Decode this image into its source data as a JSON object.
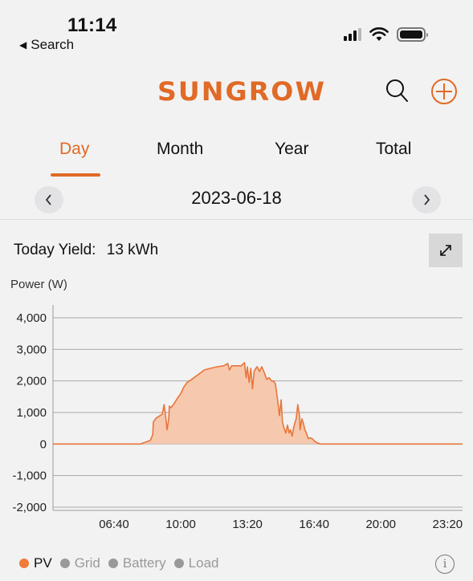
{
  "status_bar": {
    "time": "11:14",
    "back_label": "Search",
    "signal_bars": 3,
    "signal_total": 4,
    "battery_level": 1.0
  },
  "header": {
    "brand": "SUNGROW",
    "brand_color": "#e06a26",
    "search_icon": "search-icon",
    "add_icon": "plus-circle-icon"
  },
  "tabs": [
    {
      "label": "Day",
      "active": true
    },
    {
      "label": "Month",
      "active": false
    },
    {
      "label": "Year",
      "active": false
    },
    {
      "label": "Total",
      "active": false
    }
  ],
  "date_nav": {
    "date": "2023-06-18",
    "prev_icon": "chevron-left-icon",
    "next_icon": "chevron-right-icon"
  },
  "summary": {
    "yield_label": "Today Yield:",
    "yield_value": "13 kWh",
    "expand_icon": "expand-icon"
  },
  "legend": {
    "items": [
      {
        "label": "PV",
        "color": "#ef7a3a",
        "active": true
      },
      {
        "label": "Grid",
        "color": "#999999",
        "active": false
      },
      {
        "label": "Battery",
        "color": "#999999",
        "active": false
      },
      {
        "label": "Load",
        "color": "#999999",
        "active": false
      }
    ],
    "info_icon": "info-icon"
  },
  "chart_data": {
    "type": "area",
    "title": "",
    "ylabel": "Power (W)",
    "xlabel": "",
    "ylim": [
      -2000,
      4000
    ],
    "xlim_minutes": [
      217,
      1445
    ],
    "yticks": [
      4000,
      3000,
      2000,
      1000,
      0,
      -1000,
      -2000
    ],
    "ytick_labels": [
      "4,000",
      "3,000",
      "2,000",
      "1,000",
      "0",
      "-1,000",
      "-2,000"
    ],
    "xticks_minutes": [
      400,
      600,
      800,
      1000,
      1200,
      1400
    ],
    "xtick_labels": [
      "06:40",
      "10:00",
      "13:20",
      "16:40",
      "20:00",
      "23:20"
    ],
    "grid": true,
    "legend_position": "bottom-left",
    "series": [
      {
        "name": "PV",
        "color": "#e8763a",
        "fill": "#f6c8ad",
        "points": [
          [
            217,
            0
          ],
          [
            300,
            0
          ],
          [
            480,
            0
          ],
          [
            485,
            30
          ],
          [
            497,
            70
          ],
          [
            509,
            120
          ],
          [
            516,
            300
          ],
          [
            518,
            700
          ],
          [
            526,
            820
          ],
          [
            535,
            880
          ],
          [
            545,
            950
          ],
          [
            550,
            1250
          ],
          [
            554,
            950
          ],
          [
            559,
            450
          ],
          [
            564,
            800
          ],
          [
            566,
            1200
          ],
          [
            571,
            1150
          ],
          [
            581,
            1300
          ],
          [
            590,
            1450
          ],
          [
            600,
            1600
          ],
          [
            609,
            1800
          ],
          [
            619,
            1950
          ],
          [
            633,
            2050
          ],
          [
            652,
            2200
          ],
          [
            671,
            2350
          ],
          [
            690,
            2400
          ],
          [
            710,
            2450
          ],
          [
            729,
            2480
          ],
          [
            741,
            2550
          ],
          [
            746,
            2350
          ],
          [
            753,
            2480
          ],
          [
            767,
            2480
          ],
          [
            781,
            2480
          ],
          [
            791,
            2580
          ],
          [
            796,
            2100
          ],
          [
            800,
            2450
          ],
          [
            805,
            1950
          ],
          [
            810,
            2400
          ],
          [
            815,
            1750
          ],
          [
            820,
            2300
          ],
          [
            824,
            2380
          ],
          [
            829,
            2450
          ],
          [
            836,
            2300
          ],
          [
            843,
            2450
          ],
          [
            851,
            2250
          ],
          [
            858,
            2050
          ],
          [
            865,
            2100
          ],
          [
            872,
            2000
          ],
          [
            879,
            2000
          ],
          [
            884,
            1900
          ],
          [
            891,
            1350
          ],
          [
            896,
            900
          ],
          [
            901,
            1400
          ],
          [
            905,
            700
          ],
          [
            910,
            500
          ],
          [
            915,
            350
          ],
          [
            920,
            600
          ],
          [
            925,
            350
          ],
          [
            929,
            450
          ],
          [
            934,
            250
          ],
          [
            939,
            550
          ],
          [
            946,
            800
          ],
          [
            951,
            1250
          ],
          [
            956,
            900
          ],
          [
            958,
            450
          ],
          [
            963,
            800
          ],
          [
            968,
            650
          ],
          [
            972,
            450
          ],
          [
            977,
            350
          ],
          [
            982,
            180
          ],
          [
            989,
            200
          ],
          [
            996,
            150
          ],
          [
            1003,
            80
          ],
          [
            1011,
            30
          ],
          [
            1020,
            0
          ],
          [
            1445,
            0
          ]
        ]
      }
    ]
  }
}
